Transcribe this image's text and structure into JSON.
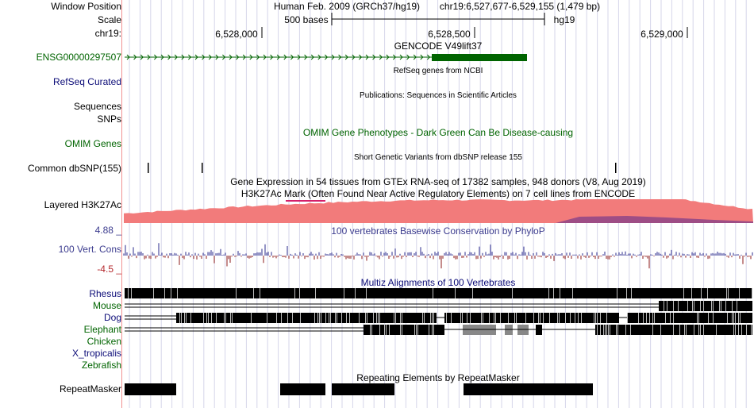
{
  "header": {
    "window_position_label": "Window Position",
    "scale_label": "Scale",
    "chr_label": "chr19:",
    "assembly": "Human Feb. 2009 (GRCh37/hg19)",
    "position": "chr19:6,527,677-6,529,155 (1,479 bp)",
    "scale_text": "500 bases",
    "db": "hg19",
    "ruler_ticks": [
      "6,528,000",
      "6,528,500",
      "6,529,000"
    ]
  },
  "tracks": {
    "gencode": {
      "label": "ENSG00000297507",
      "title": "GENCODE V49lift37"
    },
    "refseq": {
      "label": "RefSeq Curated",
      "title": "RefSeq genes from NCBI"
    },
    "publications": {
      "label": "Sequences",
      "title": "Publications: Sequences in Scientific Articles"
    },
    "snps": {
      "label": "SNPs"
    },
    "omim": {
      "label": "OMIM Genes",
      "title": "OMIM Gene Phenotypes - Dark Green Can Be Disease-causing"
    },
    "dbsnp": {
      "label": "Common dbSNP(155)",
      "title": "Short Genetic Variants from dbSNP release 155"
    },
    "gtex": {
      "title": "Gene Expression in 54 tissues from GTEx RNA-seq of 17382 samples, 948 donors (V8, Aug 2019)"
    },
    "h3k27ac": {
      "label": "Layered H3K27Ac",
      "title": "H3K27Ac Mark (Often Found Near Active Regulatory Elements) on 7 cell lines from ENCODE"
    },
    "cons": {
      "label": "100 Vert. Cons",
      "max": "4.88 _",
      "min": "-4.5 _",
      "title": "100 vertebrates Basewise Conservation by PhyloP"
    },
    "multiz": {
      "title": "Multiz Alignments of 100 Vertebrates",
      "species": [
        {
          "name": "Rhesus",
          "color": "#0c0c78"
        },
        {
          "name": "Mouse",
          "color": "#006400"
        },
        {
          "name": "Dog",
          "color": "#0c0c78"
        },
        {
          "name": "Elephant",
          "color": "#006400"
        },
        {
          "name": "Chicken",
          "color": "#006400"
        },
        {
          "name": "X_tropicalis",
          "color": "#0c0c78"
        },
        {
          "name": "Zebrafish",
          "color": "#006400"
        }
      ]
    },
    "repeatmasker": {
      "label": "RepeatMasker",
      "title": "Repeating Elements by RepeatMasker"
    }
  },
  "colors": {
    "gencode_gene": "#006400",
    "h3k27ac_fill": "#f27b7b",
    "h3k27ac_dark": "#7a3a8a",
    "cons_pos": "#2b2b8e",
    "cons_neg": "#8b1a1a",
    "grid": "#d6d6ea",
    "guide_left": "#f29191"
  }
}
